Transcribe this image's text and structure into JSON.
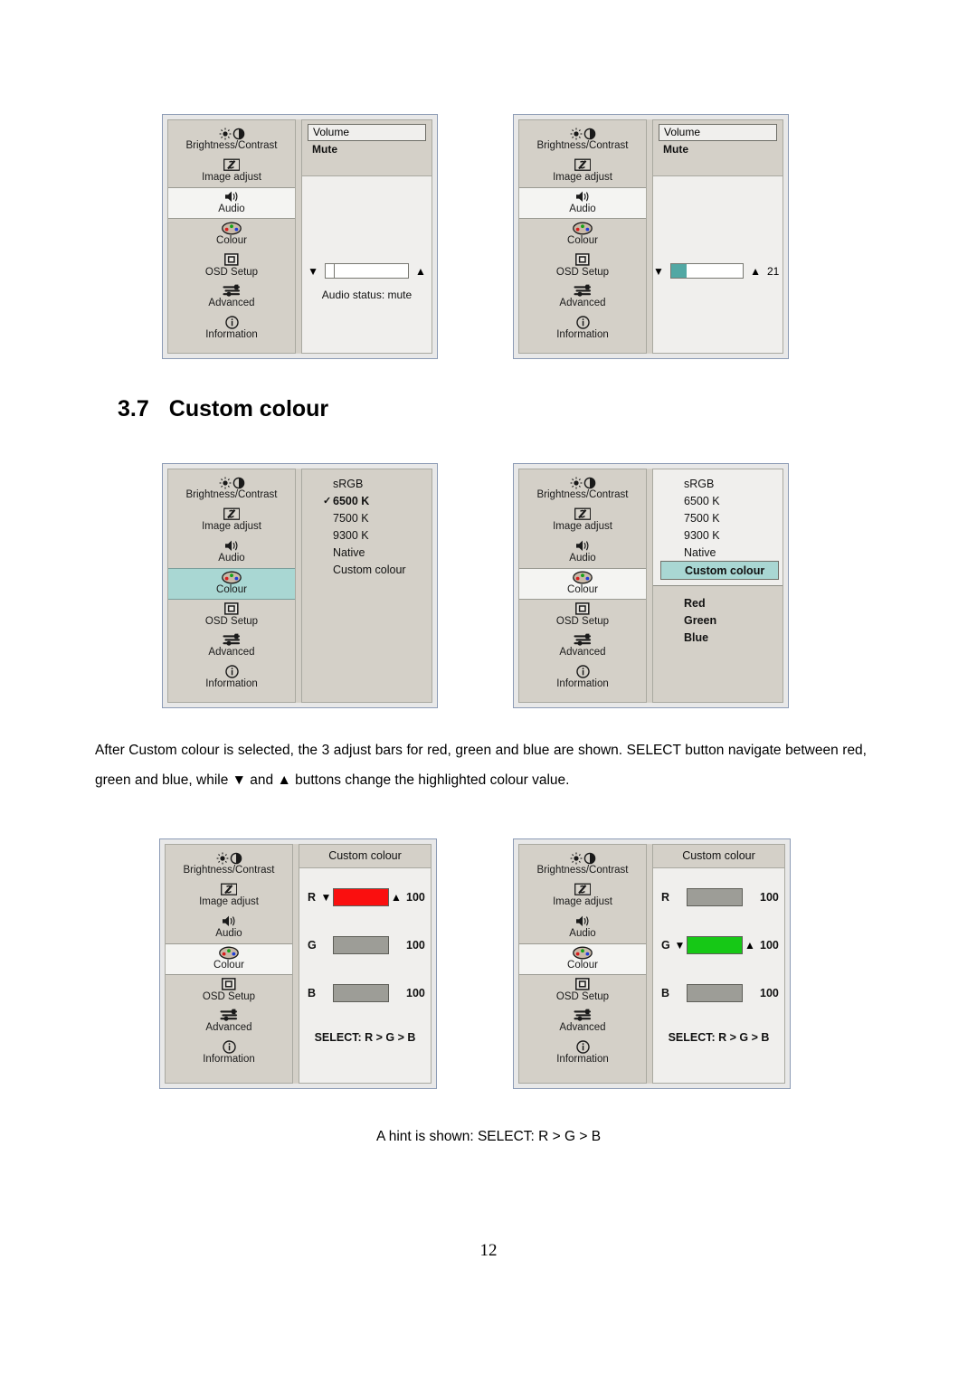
{
  "document": {
    "section_number": "3.7",
    "section_title": "Custom colour",
    "paragraph": "After Custom colour is selected, the 3 adjust bars for red, green and blue are shown. SELECT button navigate between red, green and blue, while ▼ and ▲ buttons change the highlighted colour value.",
    "caption": "A hint is shown: SELECT: R > G > B",
    "page_number": "12"
  },
  "colors": {
    "menu_background": "#d4d0c8",
    "pane_background": "#f0efed",
    "highlight_teal": "#a9d7d3",
    "slider_teal": "#52a8a4",
    "red_bar": "#fa0f0f",
    "green_bar": "#16c816",
    "gray_bar": "#9d9d97",
    "window_border": "#8c9bb5"
  },
  "nav": {
    "items": [
      {
        "label": "Brightness/Contrast",
        "icon": "brightness-contrast-icon"
      },
      {
        "label": "Image adjust",
        "icon": "image-adjust-icon"
      },
      {
        "label": "Audio",
        "icon": "audio-speaker-icon"
      },
      {
        "label": "Colour",
        "icon": "colour-palette-icon"
      },
      {
        "label": "OSD Setup",
        "icon": "osd-setup-icon"
      },
      {
        "label": "Advanced",
        "icon": "advanced-sliders-icon"
      },
      {
        "label": "Information",
        "icon": "information-icon"
      }
    ]
  },
  "panels": {
    "audio_mute": {
      "selected_nav": "Audio",
      "menu_items": [
        {
          "label": "Volume",
          "state": "boxed"
        },
        {
          "label": "Mute",
          "state": "plain"
        }
      ],
      "slider": {
        "down_arrow": "▼",
        "up_arrow": "▲",
        "fill_percent": 0,
        "value": ""
      },
      "status": "Audio status: mute"
    },
    "audio_volume": {
      "selected_nav": "Audio",
      "menu_items": [
        {
          "label": "Volume",
          "state": "boxed"
        },
        {
          "label": "Mute",
          "state": "plain"
        }
      ],
      "slider": {
        "down_arrow": "▼",
        "up_arrow": "▲",
        "fill_percent": 21,
        "value": "21"
      },
      "status": ""
    },
    "colour_list": {
      "selected_nav": "Colour",
      "nav_highlight": "teal",
      "options": [
        {
          "label": "sRGB",
          "checked": false,
          "highlighted": false
        },
        {
          "label": "6500 K",
          "checked": true,
          "highlighted": false
        },
        {
          "label": "7500 K",
          "checked": false,
          "highlighted": false
        },
        {
          "label": "9300 K",
          "checked": false,
          "highlighted": false
        },
        {
          "label": "Native",
          "checked": false,
          "highlighted": false
        },
        {
          "label": "Custom colour",
          "checked": false,
          "highlighted": false
        }
      ],
      "check_mark": "✓",
      "sub_options": []
    },
    "colour_custom_selected": {
      "selected_nav": "Colour",
      "nav_highlight": "light",
      "options": [
        {
          "label": "sRGB",
          "checked": false,
          "highlighted": false
        },
        {
          "label": "6500 K",
          "checked": false,
          "highlighted": false
        },
        {
          "label": "7500 K",
          "checked": false,
          "highlighted": false
        },
        {
          "label": "9300 K",
          "checked": false,
          "highlighted": false
        },
        {
          "label": "Native",
          "checked": false,
          "highlighted": false
        },
        {
          "label": "Custom colour",
          "checked": false,
          "highlighted": true
        }
      ],
      "check_mark": "✓",
      "sub_options": [
        {
          "label": "Red"
        },
        {
          "label": "Green"
        },
        {
          "label": "Blue"
        }
      ]
    },
    "custom_red_active": {
      "selected_nav": "Colour",
      "title": "Custom colour",
      "hint": "SELECT:  R > G > B",
      "down_arrow": "▼",
      "up_arrow": "▲",
      "channels": [
        {
          "letter": "R",
          "value": "100",
          "active": true,
          "color": "#fa0f0f"
        },
        {
          "letter": "G",
          "value": "100",
          "active": false,
          "color": "#9d9d97"
        },
        {
          "letter": "B",
          "value": "100",
          "active": false,
          "color": "#9d9d97"
        }
      ]
    },
    "custom_green_active": {
      "selected_nav": "Colour",
      "title": "Custom colour",
      "hint": "SELECT:  R > G > B",
      "down_arrow": "▼",
      "up_arrow": "▲",
      "channels": [
        {
          "letter": "R",
          "value": "100",
          "active": false,
          "color": "#9d9d97"
        },
        {
          "letter": "G",
          "value": "100",
          "active": true,
          "color": "#16c816"
        },
        {
          "letter": "B",
          "value": "100",
          "active": false,
          "color": "#9d9d97"
        }
      ]
    }
  }
}
